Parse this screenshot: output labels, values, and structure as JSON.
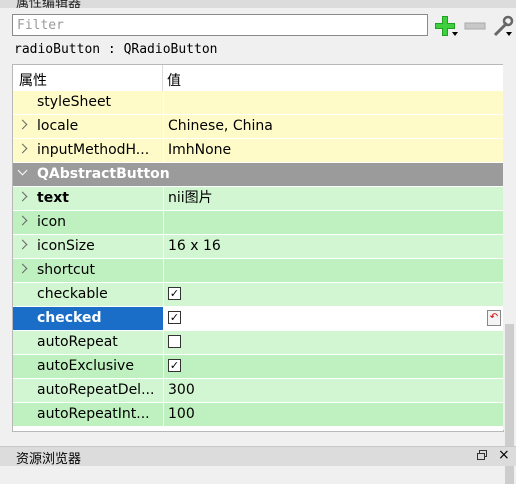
{
  "panel": {
    "title": "属性编辑器",
    "filter_placeholder": "Filter",
    "object_label": "radioButton : QRadioButton"
  },
  "grid": {
    "header": {
      "property": "属性",
      "value": "值"
    },
    "rows": [
      {
        "name": "styleSheet",
        "value": ""
      },
      {
        "name": "locale",
        "value": "Chinese, China"
      },
      {
        "name": "inputMethodH...",
        "value": "ImhNone"
      },
      {
        "name": "QAbstractButton"
      },
      {
        "name": "text",
        "value": "nii图片"
      },
      {
        "name": "icon",
        "value": ""
      },
      {
        "name": "iconSize",
        "value": "16 x 16"
      },
      {
        "name": "shortcut",
        "value": ""
      },
      {
        "name": "checkable",
        "checked": true
      },
      {
        "name": "checked",
        "checked": true
      },
      {
        "name": "autoRepeat",
        "checked": false
      },
      {
        "name": "autoExclusive",
        "checked": true
      },
      {
        "name": "autoRepeatDel...",
        "value": "300"
      },
      {
        "name": "autoRepeatInt...",
        "value": "100"
      }
    ]
  },
  "bottom_panel": {
    "title": "资源浏览器",
    "close_glyph": "×"
  },
  "icons": [
    "plus-icon",
    "minus-icon",
    "wrench-icon",
    "chevron-right-icon",
    "chevron-down-icon",
    "checkbox-checked-icon",
    "reset-icon",
    "float-icon",
    "close-icon"
  ],
  "colors": {
    "section": "#9b9b9b",
    "yellow_row": "#fffbc8",
    "green_row": "#d2f5d2",
    "selection": "#1a6ec7",
    "add_green": "#22a022"
  }
}
